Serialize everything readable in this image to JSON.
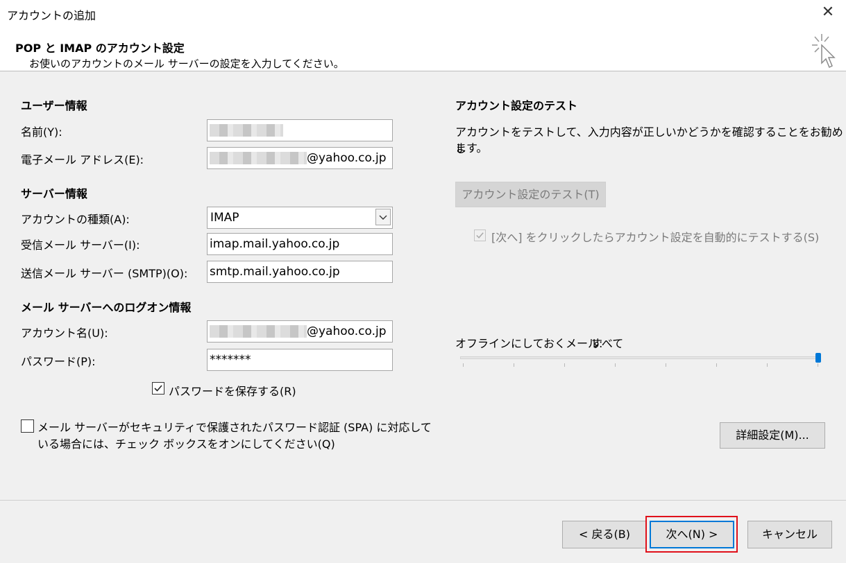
{
  "window": {
    "title": "アカウントの追加",
    "close_icon": "close-icon"
  },
  "header": {
    "title": "POP と IMAP のアカウント設定",
    "subtitle": "お使いのアカウントのメール サーバーの設定を入力してください。",
    "icon": "wand-cursor-icon"
  },
  "user_info": {
    "heading": "ユーザー情報",
    "name_label": "名前(Y):",
    "email_label": "電子メール アドレス(E):",
    "email_suffix": "@yahoo.co.jp"
  },
  "server_info": {
    "heading": "サーバー情報",
    "account_type_label": "アカウントの種類(A):",
    "account_type_value": "IMAP",
    "incoming_label": "受信メール サーバー(I):",
    "incoming_value": "imap.mail.yahoo.co.jp",
    "outgoing_label": "送信メール サーバー (SMTP)(O):",
    "outgoing_value": "smtp.mail.yahoo.co.jp"
  },
  "logon_info": {
    "heading": "メール サーバーへのログオン情報",
    "account_name_label": "アカウント名(U):",
    "account_name_suffix": "@yahoo.co.jp",
    "password_label": "パスワード(P):",
    "password_value": "*******",
    "save_password_label": "パスワードを保存する(R)",
    "save_password_checked": true,
    "spa_label_line1": "メール サーバーがセキュリティで保護されたパスワード認証 (SPA) に対応して",
    "spa_label_line2": "いる場合には、チェック ボックスをオンにしてください(Q)",
    "spa_checked": false
  },
  "test": {
    "heading": "アカウント設定のテスト",
    "desc_line1": "アカウントをテストして、入力内容が正しいかどうかを確認することをお勧めし",
    "desc_line2": "ます。",
    "test_button": "アカウント設定のテスト(T)",
    "auto_test_label": "[次へ] をクリックしたらアカウント設定を自動的にテストする(S)",
    "auto_test_checked": true
  },
  "offline": {
    "label": "オフラインにしておくメール:",
    "value": "すべて",
    "slider_level": 1.0
  },
  "more_settings_button": "詳細設定(M)...",
  "footer": {
    "back_button": "< 戻る(B)",
    "next_button": "次へ(N) >",
    "cancel_button": "キャンセル",
    "highlight_color": "#e0101a"
  }
}
